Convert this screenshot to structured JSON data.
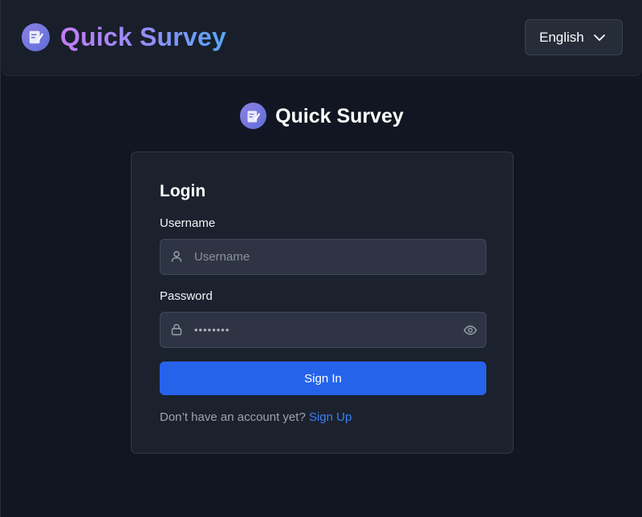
{
  "header": {
    "brand_title": "Quick Survey",
    "language_selected": "English"
  },
  "main": {
    "brand_title": "Quick Survey"
  },
  "login": {
    "title": "Login",
    "username_label": "Username",
    "username_placeholder": "Username",
    "username_value": "",
    "password_label": "Password",
    "password_value": "••••••••",
    "signin_label": "Sign In",
    "signup_prompt": "Don’t have an account yet?",
    "signup_link": "Sign Up"
  },
  "icons": {
    "logo": "survey-logo-icon",
    "language_chevron": "chevron-down-icon",
    "username": "user-icon",
    "password": "lock-icon",
    "toggle_password": "eye-icon"
  },
  "colors": {
    "background": "#111622",
    "header": "#191e2b",
    "card": "#1c212e",
    "input": "#2e3444",
    "primary": "#2563eb",
    "link": "#3b82f6",
    "brand_gradient_start": "#c47cf2",
    "brand_gradient_end": "#55a7f3"
  }
}
